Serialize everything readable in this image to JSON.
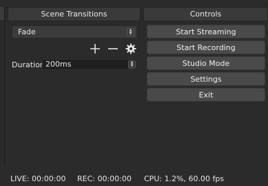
{
  "transitions": {
    "header": "Scene Transitions",
    "selected": "Fade",
    "duration_label": "Duration",
    "duration_value": "200ms",
    "icons": [
      "plus-icon",
      "minus-icon",
      "gear-icon"
    ]
  },
  "controls": {
    "header": "Controls",
    "buttons": [
      "Start Streaming",
      "Start Recording",
      "Studio Mode",
      "Settings",
      "Exit"
    ]
  },
  "status": {
    "live": "LIVE: 00:00:00",
    "rec": "REC: 00:00:00",
    "cpu": "CPU: 1.2%, 60.00 fps"
  }
}
